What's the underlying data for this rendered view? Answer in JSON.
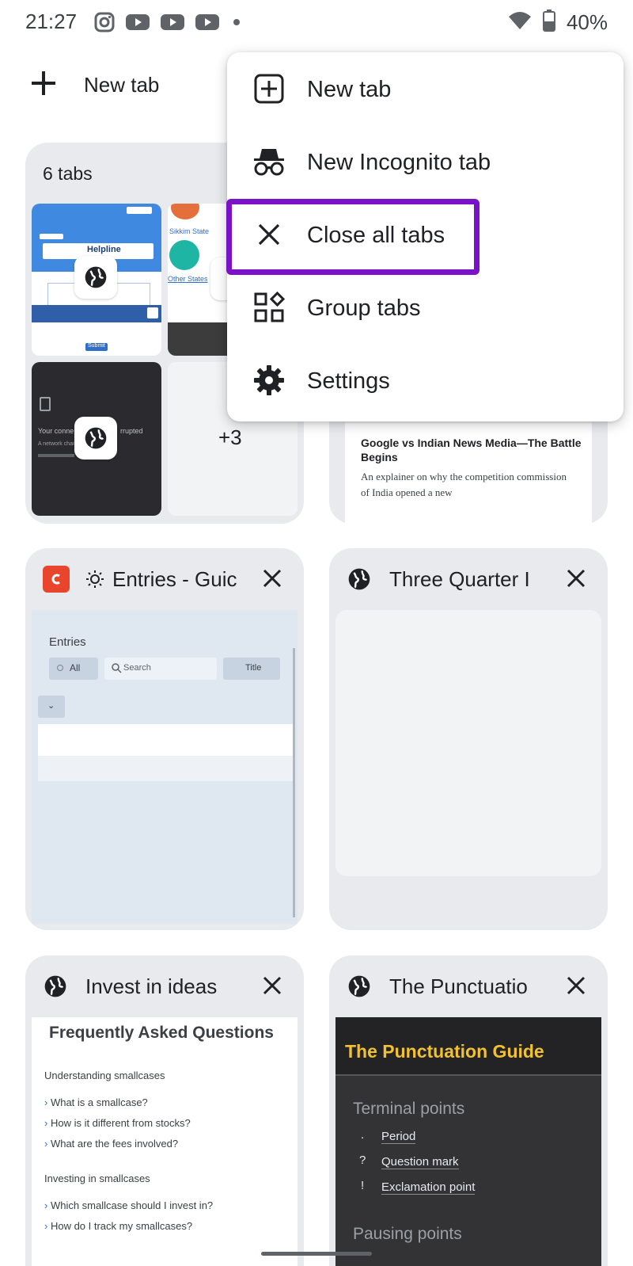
{
  "status_bar": {
    "time": "21:27",
    "battery_percent": "40%",
    "notification_icons": [
      "instagram-icon",
      "youtube-icon",
      "youtube-icon",
      "youtube-icon",
      "dot-icon"
    ],
    "right_icons": [
      "wifi-icon",
      "battery-icon"
    ]
  },
  "toolbar": {
    "new_tab_label": "New tab"
  },
  "tab_group": {
    "title": "6 tabs",
    "overflow_count": "+3",
    "thumb_texts": {
      "helpline": "Helpline",
      "sikkim": "Sikkim State",
      "other_states": "Other States",
      "submit": "Submit",
      "connection_left": "Your conne",
      "connection_right": "rrupted",
      "network": "A network change"
    }
  },
  "news_card": {
    "headline": "Google vs Indian News Media—The Battle Begins",
    "snippet": "An explainer on why the competition commission of India opened a new"
  },
  "tabs": [
    {
      "title": "Entries - Guic",
      "favicon": "c-app-icon",
      "favicon_color": "#e8452c",
      "content": {
        "heading": "Entries",
        "filter_label": "All",
        "search_placeholder": "Search",
        "sort_label": "Title"
      }
    },
    {
      "title": "Three Quarter I",
      "favicon": "globe-icon"
    },
    {
      "title": "Invest in ideas",
      "favicon": "globe-icon",
      "content": {
        "heading": "Frequently Asked Questions",
        "section1": "Understanding smallcases",
        "q1": "What is a smallcase?",
        "q2": "How is it different from stocks?",
        "q3": "What are the fees involved?",
        "section2": "Investing in smallcases",
        "q4": "Which smallcase should I invest in?",
        "q5": "How do I track my smallcases?"
      }
    },
    {
      "title": "The Punctuatio",
      "favicon": "globe-icon",
      "content": {
        "banner": "The Punctuation Guide",
        "section1": "Terminal points",
        "item1_symbol": ".",
        "item1": "Period",
        "item2_symbol": "?",
        "item2": "Question mark",
        "item3_symbol": "!",
        "item3": "Exclamation point",
        "section2": "Pausing points"
      }
    }
  ],
  "menu": {
    "items": [
      {
        "label": "New tab",
        "icon": "add-box-icon"
      },
      {
        "label": "New Incognito tab",
        "icon": "incognito-icon"
      },
      {
        "label": "Close all tabs",
        "icon": "close-icon"
      },
      {
        "label": "Group tabs",
        "icon": "group-tabs-icon"
      },
      {
        "label": "Settings",
        "icon": "gear-icon"
      }
    ],
    "highlighted_index": 2,
    "highlight_color": "#7a12c8"
  }
}
